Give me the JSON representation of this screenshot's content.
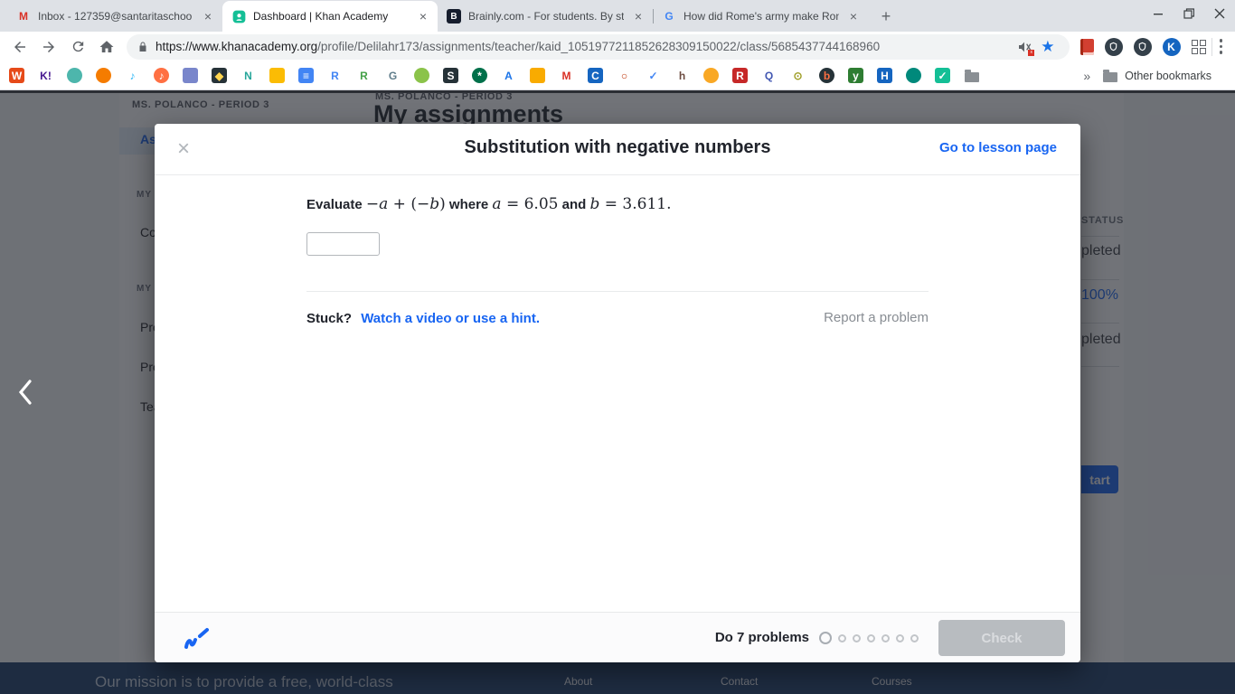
{
  "browser": {
    "tabs": [
      {
        "title": "Inbox - 127359@santaritaschoo",
        "favicon": "gmail",
        "active": false
      },
      {
        "title": "Dashboard | Khan Academy",
        "favicon": "khan",
        "active": true
      },
      {
        "title": "Brainly.com - For students. By st",
        "favicon": "brainly",
        "active": false
      },
      {
        "title": "How did Rome's army make Ron",
        "favicon": "google",
        "active": false
      }
    ],
    "url_host": "https://www.khanacademy.org",
    "url_path": "/profile/Delilahr173/assignments/teacher/kaid_1051977211852628309150022/class/5685437744168960",
    "other_bookmarks_label": "Other bookmarks",
    "bookmark_icons": [
      {
        "name": "w-red-icon",
        "g": "W",
        "c": "#e64a19",
        "f": "#fff",
        "s": "square"
      },
      {
        "name": "kahoot-icon",
        "g": "K!",
        "c": "",
        "f": "#46178f",
        "s": "plain"
      },
      {
        "name": "green-monster-icon",
        "g": "",
        "c": "#4db6ac",
        "f": "#fff",
        "s": "circle"
      },
      {
        "name": "orange-swirl-icon",
        "g": "",
        "c": "#f57c00",
        "f": "#fff",
        "s": "circle"
      },
      {
        "name": "music-note-icon",
        "g": "♪",
        "c": "",
        "f": "#29b6f6",
        "s": "plain"
      },
      {
        "name": "orange-note-icon",
        "g": "♪",
        "c": "#ff7043",
        "f": "#fff",
        "s": "circle"
      },
      {
        "name": "microphone-icon",
        "g": "",
        "c": "#7986cb",
        "f": "#fff",
        "s": "square"
      },
      {
        "name": "diamond-icon",
        "g": "◆",
        "c": "#263238",
        "f": "#ffd54f",
        "s": "square"
      },
      {
        "name": "n-teal-icon",
        "g": "N",
        "c": "",
        "f": "#26a69a",
        "s": "plain"
      },
      {
        "name": "yellow-square-icon",
        "g": "",
        "c": "#fbbc04",
        "f": "#fff",
        "s": "square"
      },
      {
        "name": "blue-doc-icon",
        "g": "≡",
        "c": "#4285f4",
        "f": "#fff",
        "s": "square"
      },
      {
        "name": "r-blue-icon",
        "g": "R",
        "c": "",
        "f": "#4285f4",
        "s": "plain"
      },
      {
        "name": "r-green-icon",
        "g": "R",
        "c": "",
        "f": "#43a047",
        "s": "plain"
      },
      {
        "name": "g-gray-icon",
        "g": "G",
        "c": "",
        "f": "#607d8b",
        "s": "plain"
      },
      {
        "name": "green-bug-icon",
        "g": "",
        "c": "#8bc34a",
        "f": "#fff",
        "s": "circle"
      },
      {
        "name": "dark-book-icon",
        "g": "S",
        "c": "#263238",
        "f": "#fff",
        "s": "square"
      },
      {
        "name": "starbucks-icon",
        "g": "*",
        "c": "#00704a",
        "f": "#fff",
        "s": "circle"
      },
      {
        "name": "a-blue-icon",
        "g": "A",
        "c": "",
        "f": "#1a73e8",
        "s": "plain"
      },
      {
        "name": "person-badge-icon",
        "g": "",
        "c": "#f9ab00",
        "f": "#fff",
        "s": "square"
      },
      {
        "name": "gmail-icon",
        "g": "M",
        "c": "",
        "f": "#d93025",
        "s": "plain"
      },
      {
        "name": "c-blue-icon",
        "g": "C",
        "c": "#1565c0",
        "f": "#fff",
        "s": "square"
      },
      {
        "name": "sketch-circle-icon",
        "g": "○",
        "c": "",
        "f": "#bf360c",
        "s": "plain"
      },
      {
        "name": "check-circle-icon",
        "g": "✓",
        "c": "",
        "f": "#4285f4",
        "s": "plain"
      },
      {
        "name": "h-brown-icon",
        "g": "h",
        "c": "",
        "f": "#6d4c41",
        "s": "plain"
      },
      {
        "name": "yellow-dot-icon",
        "g": "",
        "c": "#f9a825",
        "f": "#fff",
        "s": "circle"
      },
      {
        "name": "tr-red-icon",
        "g": "R",
        "c": "#c62828",
        "f": "#fff",
        "s": "square"
      },
      {
        "name": "q-purple-icon",
        "g": "Q",
        "c": "",
        "f": "#4257b2",
        "s": "plain"
      },
      {
        "name": "camera-icon",
        "g": "⊙",
        "c": "",
        "f": "#9e9d24",
        "s": "plain"
      },
      {
        "name": "flame-circle-icon",
        "g": "b",
        "c": "#263238",
        "f": "#ff7043",
        "s": "circle"
      },
      {
        "name": "y-green-icon",
        "g": "y",
        "c": "#2e7d32",
        "f": "#fff",
        "s": "square"
      },
      {
        "name": "hn-blue-icon",
        "g": "H",
        "c": "#1565c0",
        "f": "#fff",
        "s": "square"
      },
      {
        "name": "speech-bubble-icon",
        "g": "",
        "c": "#00897b",
        "f": "#fff",
        "s": "circle"
      },
      {
        "name": "khan-shield-icon",
        "g": "✓",
        "c": "#14bf96",
        "f": "#fff",
        "s": "square"
      },
      {
        "name": "folder-icon",
        "g": "",
        "c": "#8a8f94",
        "f": "",
        "s": "folder"
      }
    ]
  },
  "page": {
    "sidebar": {
      "class_label": "MS. POLANCO - PERIOD 3",
      "items": [
        {
          "text": "Ass",
          "role": "sel"
        },
        {
          "text": "MY",
          "role": "hd"
        },
        {
          "text": "Cou",
          "role": "it"
        },
        {
          "text": "MY",
          "role": "hd"
        },
        {
          "text": "Pro",
          "role": "it"
        },
        {
          "text": "Pro",
          "role": "it"
        },
        {
          "text": "Tea",
          "role": "it"
        }
      ]
    },
    "main": {
      "class_label": "MS. POLANCO - PERIOD 3",
      "title": "My assignments",
      "status_header": "STATUS",
      "status_rows": [
        "pleted",
        "100%",
        "pleted"
      ],
      "start_label": "tart"
    },
    "footer": {
      "mission": "Our mission is to provide a free, world-class",
      "links": [
        "About",
        "Contact",
        "Courses"
      ]
    }
  },
  "modal": {
    "title": "Substitution with negative numbers",
    "lesson_link": "Go to lesson page",
    "question_parts": [
      {
        "t": "Evaluate ",
        "style": "label"
      },
      {
        "t": "−",
        "style": "math"
      },
      {
        "t": "a",
        "style": "mathvar"
      },
      {
        "t": " + (−",
        "style": "math"
      },
      {
        "t": "b",
        "style": "mathvar"
      },
      {
        "t": ")",
        "style": "math"
      },
      {
        "t": " where ",
        "style": "label"
      },
      {
        "t": "a",
        "style": "mathvar"
      },
      {
        "t": " = 6.05",
        "style": "math"
      },
      {
        "t": " and ",
        "style": "label"
      },
      {
        "t": "b",
        "style": "mathvar"
      },
      {
        "t": " = 3.611.",
        "style": "math"
      }
    ],
    "answer_value": "",
    "stuck_label": "Stuck?",
    "hint_link": "Watch a video or use a hint.",
    "report_link": "Report a problem",
    "progress_label": "Do 7 problems",
    "dots_total": 7,
    "dots_current": 1,
    "check_label": "Check"
  },
  "colors": {
    "khan_blue": "#1865f2",
    "khan_green": "#14bf96",
    "overlay": "rgba(33,36,44,0.64)",
    "footer_navy": "#1b3a66",
    "chrome_tabstrip": "#dee1e6",
    "check_disabled_bg": "#b8bcc0"
  }
}
